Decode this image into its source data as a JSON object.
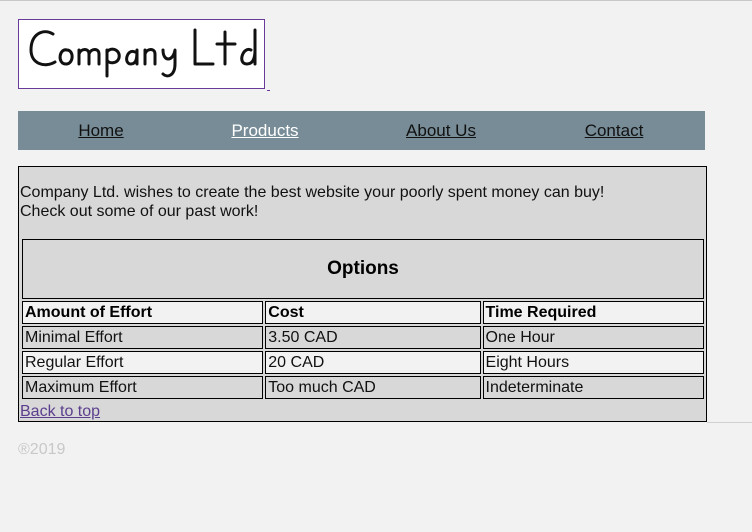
{
  "logo": {
    "text": "Company Ltd"
  },
  "nav": {
    "items": [
      {
        "label": "Home",
        "active": false
      },
      {
        "label": "Products",
        "active": true
      },
      {
        "label": "About Us",
        "active": false
      },
      {
        "label": "Contact",
        "active": false
      }
    ]
  },
  "intro": {
    "line1": "Company Ltd. wishes to create the best website your poorly spent money can buy!",
    "line2": "Check out some of our past work!"
  },
  "options_table": {
    "caption": "Options",
    "headers": [
      "Amount of Effort",
      "Cost",
      "Time Required"
    ],
    "rows": [
      [
        "Minimal Effort",
        "3.50 CAD",
        "One Hour"
      ],
      [
        "Regular Effort",
        "20 CAD",
        "Eight Hours"
      ],
      [
        "Maximum Effort",
        "Too much CAD",
        "Indeterminate"
      ]
    ]
  },
  "back_to_top": "Back to top",
  "footer": {
    "copyright": "®2019"
  },
  "colors": {
    "navbar": "#778c97",
    "content_bg": "#d8d8d8",
    "page_bg": "#f2f2f2",
    "link_visited": "#5b3e8e",
    "nav_active": "#ffffff"
  }
}
